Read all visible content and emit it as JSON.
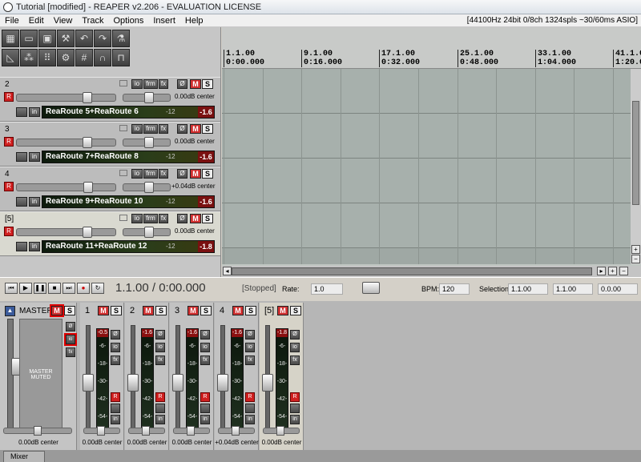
{
  "window": {
    "title": "Tutorial [modified] - REAPER v2.206 - EVALUATION LICENSE"
  },
  "menu": {
    "items": [
      "File",
      "Edit",
      "View",
      "Track",
      "Options",
      "Insert",
      "Help"
    ],
    "status": "[44100Hz 24bit 0/8ch 1324spls ~30/60ms ASIO]"
  },
  "toolbar": {
    "icons": [
      "metronome-icon",
      "open-icon",
      "save-icon",
      "settings-icon",
      "undo-icon",
      "redo-icon",
      "flask-icon",
      "envelope-icon",
      "grouping-icon",
      "snap-icon",
      "ripple-icon",
      "grid-icon",
      "magnet-icon",
      "lock-icon"
    ]
  },
  "tracks": [
    {
      "num": "2",
      "vol": "0.00dB center",
      "name": "ReaRoute 5+ReaRoute 6",
      "db": "-12",
      "peak": "-1.6"
    },
    {
      "num": "3",
      "vol": "0.00dB center",
      "name": "ReaRoute 7+ReaRoute 8",
      "db": "-12",
      "peak": "-1.6"
    },
    {
      "num": "4",
      "vol": "+0.04dB center",
      "name": "ReaRoute 9+ReaRoute 10",
      "db": "-12",
      "peak": "-1.6"
    },
    {
      "num": "[5]",
      "vol": "0.00dB center",
      "name": "ReaRoute 11+ReaRoute 12",
      "db": "-12",
      "peak": "-1.8"
    }
  ],
  "track_buttons": {
    "io": "io",
    "frm": "frm",
    "fx": "fx",
    "phase": "Ø",
    "mute": "M",
    "solo": "S",
    "rec": "R",
    "in": "in"
  },
  "ruler": [
    {
      "bar": "1.1.00",
      "time": "0:00.000"
    },
    {
      "bar": "9.1.00",
      "time": "0:16.000"
    },
    {
      "bar": "17.1.00",
      "time": "0:32.000"
    },
    {
      "bar": "25.1.00",
      "time": "0:48.000"
    },
    {
      "bar": "33.1.00",
      "time": "1:04.000"
    },
    {
      "bar": "41.1.0",
      "time": "1:20.0"
    }
  ],
  "transport": {
    "position": "1.1.00 / 0:00.000",
    "status": "[Stopped]",
    "rate_label": "Rate:",
    "rate": "1.0",
    "bpm_label": "BPM:",
    "bpm": "120",
    "selection_label": "Selection:",
    "sel_start": "1.1.00",
    "sel_end": "1.1.00",
    "sel_len": "0.0.00"
  },
  "mixer": {
    "master": {
      "title": "MASTER",
      "muted_text": "MASTER MUTED",
      "vol": "0.00dB center"
    },
    "strips": [
      {
        "num": "1",
        "peak": "-0.5",
        "vol": "0.00dB center"
      },
      {
        "num": "2",
        "peak": "-1.6",
        "vol": "0.00dB center"
      },
      {
        "num": "3",
        "peak": "-1.6",
        "vol": "0.00dB center"
      },
      {
        "num": "4",
        "peak": "-1.6",
        "vol": "+0.04dB center"
      },
      {
        "num": "[5]",
        "peak": "-1.8",
        "vol": "0.00dB center"
      }
    ],
    "scale": [
      "-6-",
      "-18-",
      "-30-",
      "-42-",
      "-54-"
    ],
    "tab": "Mixer"
  },
  "colors": {
    "accent": "#d02020",
    "meter": "#1f301f",
    "highlight": "#e00000"
  }
}
